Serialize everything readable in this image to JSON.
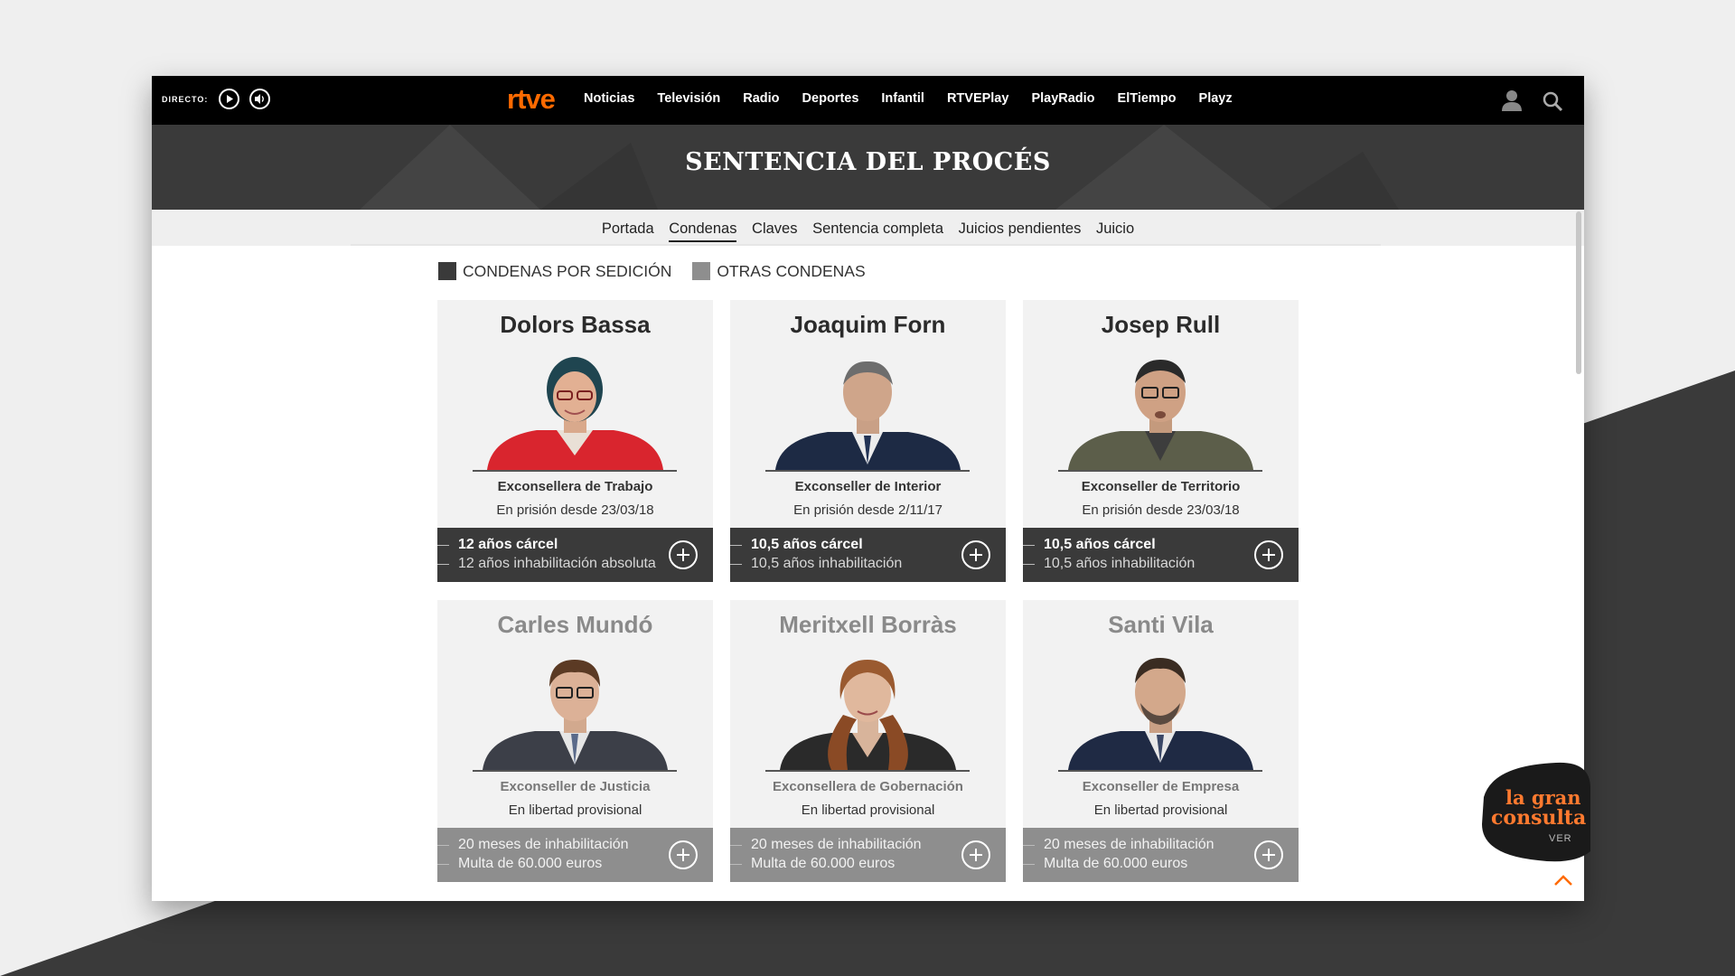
{
  "topbar": {
    "directo_label": "DIRECTO:",
    "logo": "rtve",
    "nav": [
      "Noticias",
      "Televisión",
      "Radio",
      "Deportes",
      "Infantil",
      "RTVEPlay",
      "PlayRadio",
      "ElTiempo",
      "Playz"
    ]
  },
  "banner": {
    "title": "SENTENCIA DEL PROCÉS"
  },
  "subnav": [
    "Portada",
    "Condenas",
    "Claves",
    "Sentencia completa",
    "Juicios pendientes",
    "Juicio"
  ],
  "legend": {
    "sedicion": {
      "label": "CONDENAS POR SEDICIÓN",
      "color": "#3a3a3a"
    },
    "otras": {
      "label": "OTRAS CONDENAS",
      "color": "#8e8e8e"
    }
  },
  "cards": [
    {
      "name": "Dolors Bassa",
      "role": "Exconsellera de Trabajo",
      "status": "En prisión desde 23/03/18",
      "line1": "12 años cárcel",
      "line2": "12 años inhabilitación absoluta"
    },
    {
      "name": "Joaquim Forn",
      "role": "Exconseller de Interior",
      "status": "En prisión desde 2/11/17",
      "line1": "10,5 años cárcel",
      "line2": "10,5 años inhabilitación"
    },
    {
      "name": "Josep Rull",
      "role": "Exconseller de Territorio",
      "status": "En prisión desde 23/03/18",
      "line1": "10,5 años cárcel",
      "line2": "10,5 años inhabilitación"
    },
    {
      "name": "Carles Mundó",
      "role": "Exconseller de Justicia",
      "status": "En libertad provisional",
      "line1": "20 meses de inhabilitación",
      "line2": "Multa de 60.000 euros"
    },
    {
      "name": "Meritxell Borràs",
      "role": "Exconsellera de Gobernación",
      "status": "En libertad provisional",
      "line1": "20 meses de inhabilitación",
      "line2": "Multa de 60.000 euros"
    },
    {
      "name": "Santi Vila",
      "role": "Exconseller de Empresa",
      "status": "En libertad provisional",
      "line1": "20 meses de inhabilitación",
      "line2": "Multa de 60.000 euros"
    }
  ],
  "badge": {
    "line1": "la gran",
    "line2": "consulta",
    "cta": "VER"
  }
}
